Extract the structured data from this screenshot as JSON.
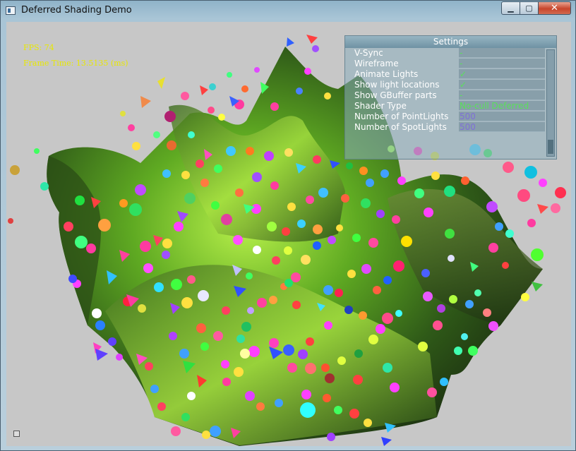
{
  "window": {
    "title": "Deferred Shading Demo",
    "minimize_icon": "minimize-icon",
    "maximize_icon": "maximize-icon",
    "close_icon": "close-icon"
  },
  "stats": {
    "fps": "FPS: 74",
    "frame_time": "Frame Time: 13.5135 (ms)"
  },
  "settings": {
    "title": "Settings",
    "rows": [
      {
        "label": "V-Sync",
        "value": "-"
      },
      {
        "label": "Wireframe",
        "value": "-"
      },
      {
        "label": "Animate Lights",
        "value": "✓"
      },
      {
        "label": "Show light locations",
        "value": "✓"
      },
      {
        "label": "Show GBuffer parts",
        "value": "-"
      },
      {
        "label": "Shader Type",
        "value": "No-cull Deferred"
      },
      {
        "label": "Number of PointLights",
        "value": "500"
      },
      {
        "label": "Number of SpotLights",
        "value": "500"
      }
    ]
  },
  "colors": {
    "stats_text": "#e8e800",
    "value_text": "#59e05a",
    "number_text": "#7f6fd8",
    "viewport_bg": "#c7c7c7"
  }
}
